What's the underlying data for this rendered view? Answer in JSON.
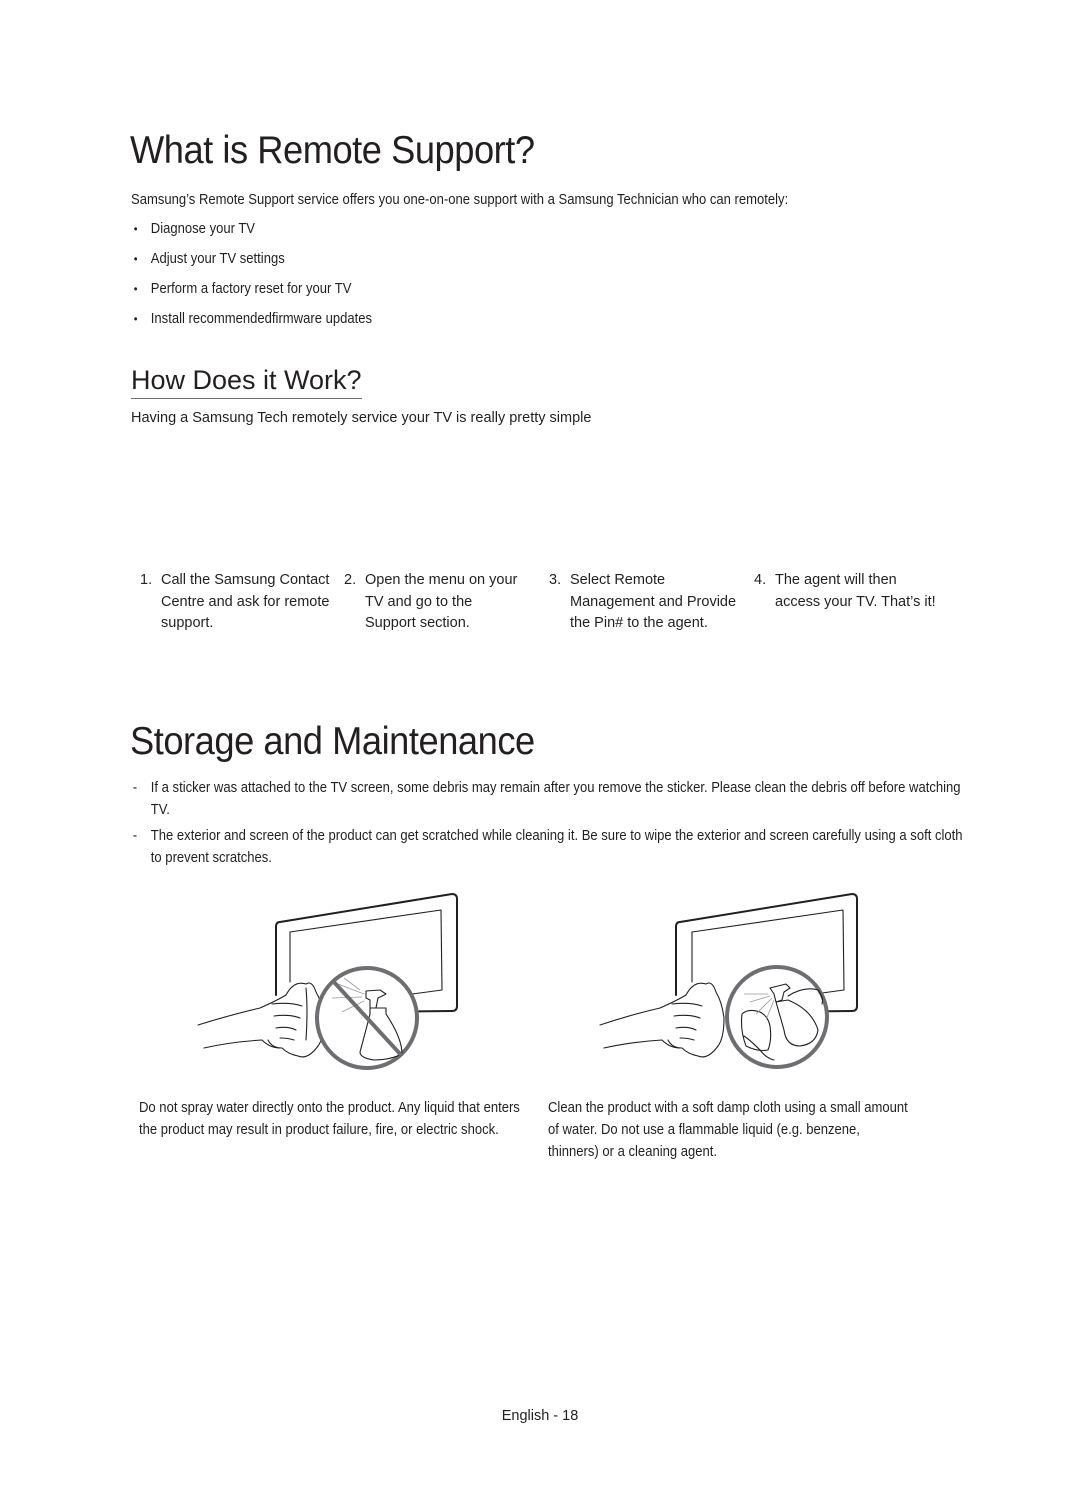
{
  "remote_support": {
    "title": "What is Remote Support?",
    "intro": "Samsung’s Remote Support service offers you one-on-one support with a Samsung Technician who can remotely:",
    "bullets": [
      "Diagnose your TV",
      "Adjust your TV settings",
      "Perform a factory reset for your TV",
      "Install recommendedfirmware updates"
    ],
    "bullet_symbol": "•"
  },
  "how_it_works": {
    "title": "How Does it Work?",
    "intro": "Having a Samsung Tech remotely service your TV is really pretty simple",
    "steps": [
      {
        "num": "1.",
        "text": "Call the Samsung Contact Centre and ask for remote support."
      },
      {
        "num": "2.",
        "text": "Open the menu on your TV and go to the Support section."
      },
      {
        "num": "3.",
        "text": "Select Remote Management and Provide the Pin# to the agent."
      },
      {
        "num": "4.",
        "text": "The agent will then access your TV. That’s it!"
      }
    ]
  },
  "storage": {
    "title": "Storage and Maintenance",
    "dash_symbol": "-",
    "items": [
      "If a sticker was attached to the TV screen, some debris may remain after you remove the sticker. Please clean the debris off before watching TV.",
      "The exterior and screen of the product can get scratched while cleaning it. Be sure to wipe the exterior and screen carefully using a soft cloth to prevent scratches."
    ],
    "illustrations": [
      {
        "icon": "no-spray-icon",
        "caption": "Do not spray water directly onto the product. Any liquid that enters the product may result in product failure, fire, or electric shock."
      },
      {
        "icon": "spray-cloth-icon",
        "caption": "Clean the product with a soft damp cloth using a small amount of water. Do not use a flammable liquid (e.g. benzene, thinners) or a cleaning agent."
      }
    ]
  },
  "footer": {
    "page_label": "English - 18"
  },
  "colors": {
    "text": "#231f20",
    "rule": "#6d6e71"
  }
}
